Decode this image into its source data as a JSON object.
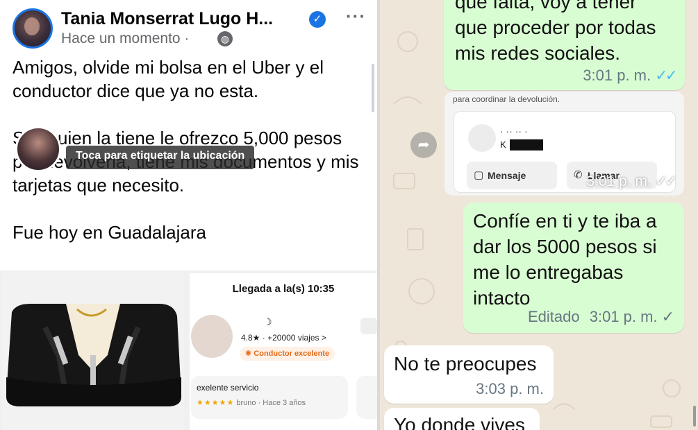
{
  "facebook_post": {
    "author": "Tania Monserrat Lugo H...",
    "verified_icon": "verified-badge-icon",
    "timestamp": "Hace un momento",
    "visibility_icon": "globe-icon",
    "more_icon": "more-options-icon",
    "body_paragraphs": [
      "Amigos, olvide mi bolsa en el Uber y el conductor dice que ya no esta.",
      "Si alguien la tiene le ofrezco 5,000 pesos por devolverla, tiene mis documentos y mis tarjetas que necesito.",
      "Fue hoy en Guadalajara"
    ],
    "photo_tag_tip": "Toca para etiquetar la ubicación",
    "uber_screenshot": {
      "arrival": "Llegada a la(s) 10:35",
      "rating": "4.8★ · +20000 viajes >",
      "badge": "Conductor excelente",
      "review_text": "exelente servicio",
      "review_meta": "bruno · Hace 3 años",
      "review_stars": "★★★★★"
    }
  },
  "whatsapp_chat": {
    "messages": [
      {
        "direction": "out",
        "text": "que falta, voy a tener que proceder por todas mis redes sociales.",
        "time": "3:01 p. m.",
        "status": "read"
      },
      {
        "direction": "out",
        "type": "contact-card",
        "caption": "para coordinar la devolución.",
        "contact_prefix": "K",
        "btn_message": "Mensaje",
        "btn_call": "Llamar",
        "time": "3:01 p. m.",
        "status": "read"
      },
      {
        "direction": "out",
        "text": "Confíe en ti y te iba a dar los 5000 pesos si me lo entregabas intacto",
        "edited_label": "Editado",
        "time": "3:01 p. m.",
        "status": "sent"
      },
      {
        "direction": "in",
        "text": "No te preocupes",
        "time": "3:03 p. m."
      },
      {
        "direction": "in",
        "text": "Yo donde vives"
      }
    ],
    "forward_icon": "forward-icon"
  }
}
